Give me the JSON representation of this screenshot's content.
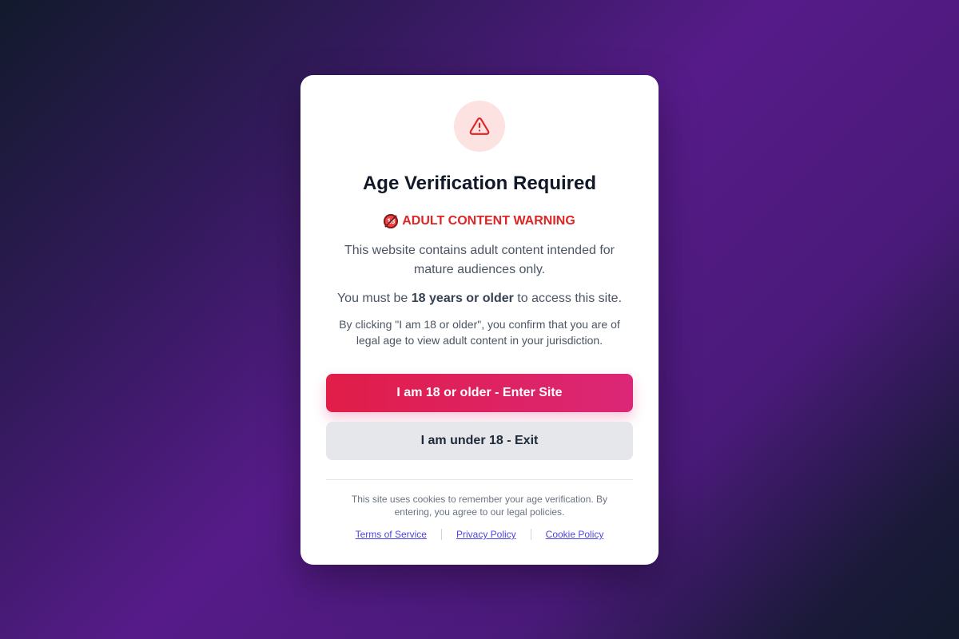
{
  "modal": {
    "icon": "warning-triangle-icon",
    "title": "Age Verification Required",
    "warning_badge": "18",
    "warning_text": "ADULT CONTENT WARNING",
    "description": "This website contains adult content intended for mature audiences only.",
    "age_requirement": {
      "prefix": "You must be ",
      "emphasis": "18 years or older",
      "suffix": " to access this site."
    },
    "confirmation": "By clicking \"I am 18 or older\", you confirm that you are of legal age to view adult content in your jurisdiction.",
    "enter_button": "I am 18 or older - Enter Site",
    "exit_button": "I am under 18 - Exit",
    "cookie_note": "This site uses cookies to remember your age verification. By entering, you agree to our legal policies.",
    "links": {
      "terms": "Terms of Service",
      "privacy": "Privacy Policy",
      "cookie": "Cookie Policy"
    }
  },
  "colors": {
    "warning_red": "#dc2626",
    "enter_gradient_start": "#e11d48",
    "enter_gradient_end": "#db2777",
    "link": "#4f46e5"
  }
}
